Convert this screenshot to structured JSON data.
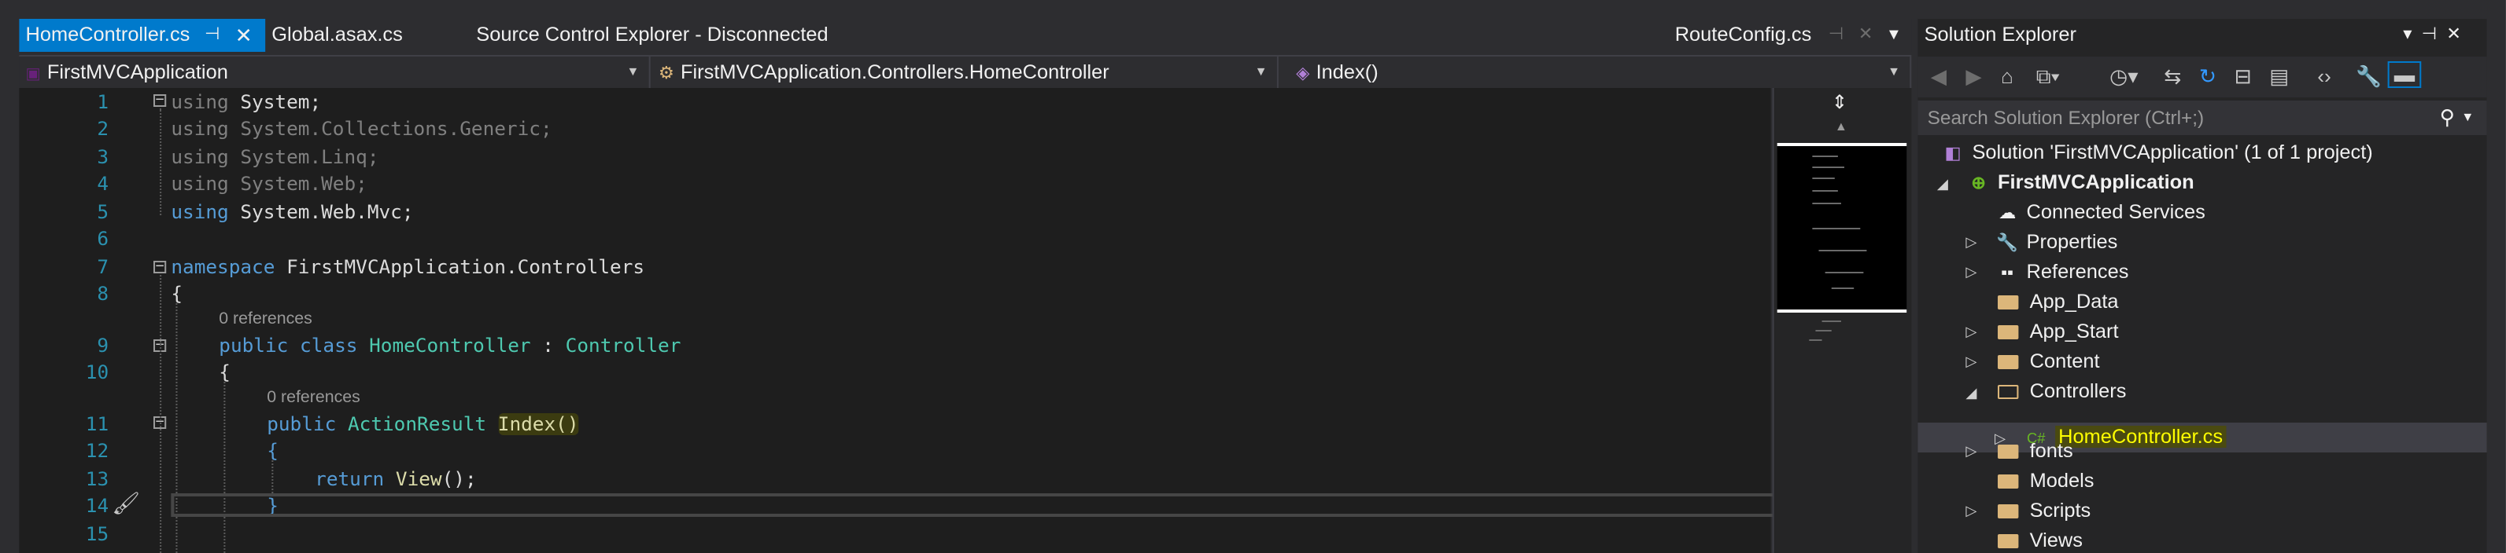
{
  "tabs": {
    "active": "HomeController.cs",
    "second": "Global.asax.cs",
    "third": "Source Control Explorer - Disconnected",
    "right": "RouteConfig.cs",
    "pin_glyph": "⊣",
    "close_glyph": "✕"
  },
  "navbar": {
    "project": "FirstMVCApplication",
    "class": "FirstMVCApplication.Controllers.HomeController",
    "member": "Index()"
  },
  "editor": {
    "line_numbers": [
      "1",
      "2",
      "3",
      "4",
      "5",
      "6",
      "7",
      "8",
      "9",
      "10",
      "11",
      "12",
      "13",
      "14",
      "15"
    ],
    "using_kw": "using",
    "usings": [
      "System;",
      "System.Collections.Generic;",
      "System.Linq;",
      "System.Web;",
      "System.Web.Mvc;"
    ],
    "namespace_kw": "namespace",
    "namespace_name": "FirstMVCApplication.Controllers",
    "open_brace": "{",
    "close_brace": "}",
    "references_label": "0 references",
    "class_public": "public",
    "class_kw": "class",
    "class_name": "HomeController",
    "class_colon": ":",
    "class_base": "Controller",
    "method_public": "public",
    "method_type": "ActionResult",
    "method_name": "Index()",
    "return_kw": "return",
    "return_call": "View",
    "return_rest": "();"
  },
  "solution_explorer": {
    "title": "Solution Explorer",
    "search_placeholder": "Search Solution Explorer (Ctrl+;)",
    "solution": "Solution 'FirstMVCApplication' (1 of 1 project)",
    "project": "FirstMVCApplication",
    "items": [
      "Connected Services",
      "Properties",
      "References",
      "App_Data",
      "App_Start",
      "Content",
      "Controllers",
      "HomeController.cs",
      "fonts",
      "Models",
      "Scripts",
      "Views"
    ]
  },
  "colors": {
    "accent": "#007acc",
    "editor_bg": "#1e1e1e",
    "keyword": "#569cd6",
    "type": "#4ec9b0",
    "highlight": "#ffff00"
  }
}
